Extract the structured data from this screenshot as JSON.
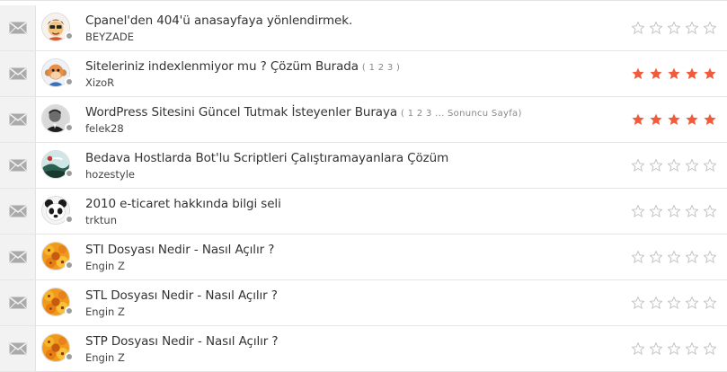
{
  "colors": {
    "star_filled": "#f15a3a",
    "star_empty": "#c4c4c4",
    "status_dot": "#9d9d9d",
    "icon_column_bg": "#f2f2f2",
    "envelope": "#aaaaaa"
  },
  "threads": [
    {
      "title": "Cpanel'den 404'ü anasayfaya yönlendirmek.",
      "pages": "",
      "author": "BEYZADE",
      "rating": 0,
      "avatar": "cartoon-avatar"
    },
    {
      "title": "Siteleriniz indexlenmiyor mu ? Çözüm Burada",
      "pages": "( 1 2 3 )",
      "author": "XizoR",
      "rating": 5,
      "avatar": "monkey-avatar"
    },
    {
      "title": "WordPress Sitesini Güncel Tutmak İsteyenler Buraya",
      "pages": "( 1 2 3 ... Sonuncu Sayfa)",
      "author": "felek28",
      "rating": 5,
      "avatar": "portrait-avatar"
    },
    {
      "title": "Bedava Hostlarda Bot'lu Scriptleri Çalıştıramayanlara Çözüm",
      "pages": "",
      "author": "hozestyle",
      "rating": 0,
      "avatar": "landscape-avatar"
    },
    {
      "title": "2010 e-ticaret hakkında bilgi seli",
      "pages": "",
      "author": "trktun",
      "rating": 0,
      "avatar": "panda-avatar"
    },
    {
      "title": "STI Dosyası Nedir - Nasıl Açılır ?",
      "pages": "",
      "author": "Engin Z",
      "rating": 0,
      "avatar": "flower-avatar"
    },
    {
      "title": "STL Dosyası Nedir - Nasıl Açılır ?",
      "pages": "",
      "author": "Engin Z",
      "rating": 0,
      "avatar": "flower-avatar"
    },
    {
      "title": "STP Dosyası Nedir - Nasıl Açılır ?",
      "pages": "",
      "author": "Engin Z",
      "rating": 0,
      "avatar": "flower-avatar"
    }
  ]
}
